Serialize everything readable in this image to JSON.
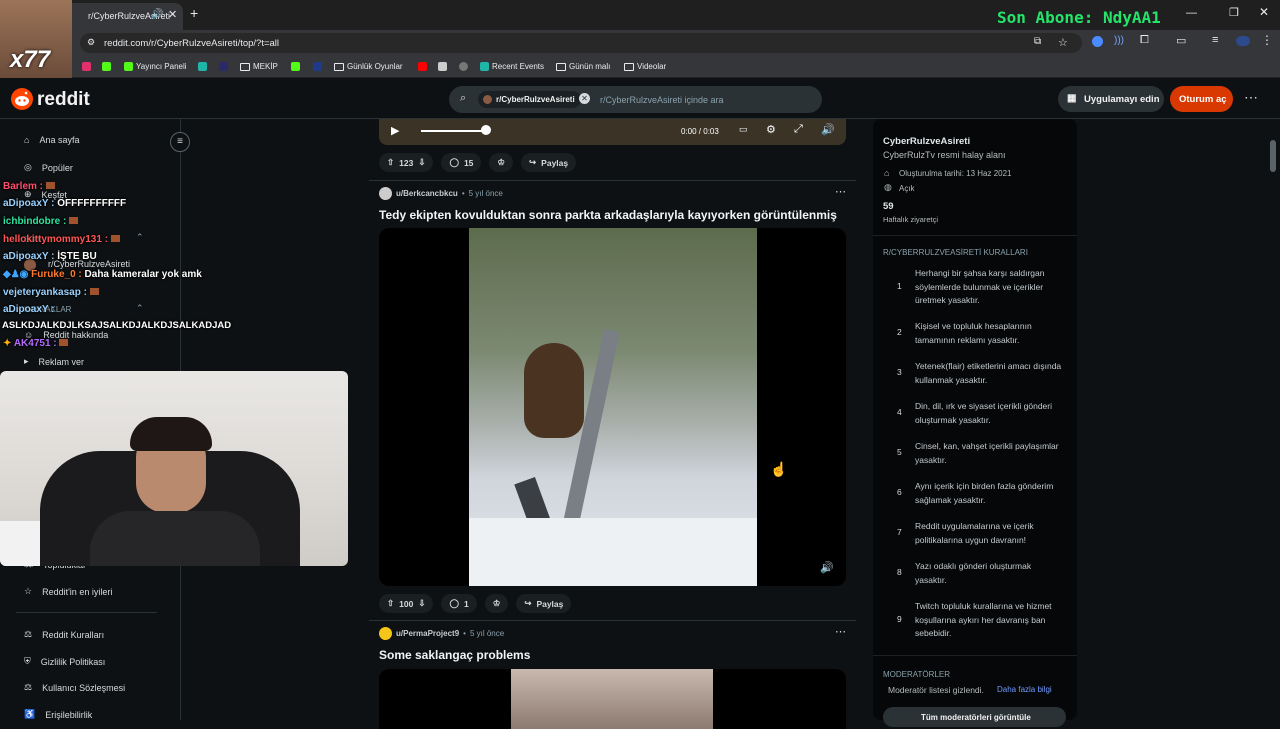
{
  "browser": {
    "tab_title": "r/CyberRulzveAsireti",
    "url": "reddit.com/r/CyberRulzveAsireti/top/?t=all",
    "bookmarks": [
      "Yayıncı Paneli",
      "MEKİP",
      "Günlük Oyunlar",
      "Recent Events",
      "Günün malı",
      "Videolar"
    ]
  },
  "overlay": {
    "sub_banner": "Son Abone: NdyAA1",
    "badge": "x77",
    "chat": [
      {
        "user": "Barlem :",
        "text": "",
        "color": "#ff4d6d"
      },
      {
        "user": "aDipoaxY :",
        "text": "ÖFFFFFFFFFF",
        "color": "#9ad2ff"
      },
      {
        "user": "ichbindobre :",
        "text": "",
        "color": "#30e3a0"
      },
      {
        "user": "hellokittymommy131 :",
        "text": "",
        "color": "#ff5555"
      },
      {
        "user": "aDipoaxY :",
        "text": "İŞTE BU",
        "color": "#9ad2ff"
      },
      {
        "user": "Furuke_0 :",
        "text": "Daha kameralar yok amk",
        "color": "#ff7a2f"
      },
      {
        "user": "vejeteryankasap :",
        "text": "",
        "color": "#9ad2ff"
      },
      {
        "user": "aDipoaxY :",
        "text": "",
        "color": "#9ad2ff"
      },
      {
        "user": "",
        "text": "ASLKDJALKDJLKSAJSALKDJALKDJSALKADJAD",
        "color": "#ffffff"
      },
      {
        "user": "AK4751 :",
        "text": "",
        "color": "#b46cff"
      }
    ]
  },
  "header": {
    "logo": "reddit",
    "search_chip": "r/CyberRulzveAsireti",
    "search_placeholder": "r/CyberRulzveAsireti içinde ara",
    "get_app": "Uygulamayı edin",
    "login": "Oturum aç"
  },
  "left_nav": {
    "home": "Ana sayfa",
    "popular": "Popüler",
    "explore": "Keşfet",
    "recent_label": "SON",
    "recent_item": "r/CyberRulzveAsireti",
    "resources": "KAYNAKLAR",
    "about": "Reddit hakkında",
    "ads": "Reklam ver",
    "communities": "Topluluklar",
    "best": "Reddit'in en iyileri",
    "rules": "Reddit Kuralları",
    "privacy": "Gizlilik Politikası",
    "agreement": "Kullanıcı Sözleşmesi",
    "access": "Erişilebilirlik"
  },
  "feed": {
    "video_time": "0:00 / 0:03",
    "post0": {
      "votes": "123",
      "comments": "15",
      "share": "Paylaş"
    },
    "post1": {
      "author": "u/Berkcancbkcu",
      "age": "5 yıl önce",
      "title": "Tedy ekipten kovulduktan sonra parkta arkadaşlarıyla kayıyorken görüntülenmiş",
      "votes": "100",
      "comments": "1",
      "share": "Paylaş"
    },
    "post2": {
      "author": "u/PermaProject9",
      "age": "5 yıl önce",
      "title": "Some saklangaç problems"
    }
  },
  "sidebar": {
    "name": "CyberRulzveAsireti",
    "desc": "CyberRulzTv resmi halay alanı",
    "created": "Oluşturulma tarihi: 13 Haz 2021",
    "visibility": "Açık",
    "weekly_count": "59",
    "weekly_label": "Haftalık ziyaretçi",
    "rules_heading": "R/CYBERRULZVEASİRETİ KURALLARI",
    "rules": [
      {
        "n": "1",
        "text": "Herhangi bir şahsa karşı saldırgan söylemlerde bulunmak ve içerikler üretmek yasaktır."
      },
      {
        "n": "2",
        "text": "Kişisel ve topluluk hesaplarının tamamının reklamı yasaktır."
      },
      {
        "n": "3",
        "text": "Yetenek(flair) etiketlerini amacı dışında kullanmak yasaktır."
      },
      {
        "n": "4",
        "text": "Din, dil, ırk ve siyaset içerikli gönderi oluşturmak yasaktır."
      },
      {
        "n": "5",
        "text": "Cinsel, kan, vahşet içerikli paylaşımlar yasaktır."
      },
      {
        "n": "6",
        "text": "Aynı içerik için birden fazla gönderim sağlamak yasaktır."
      },
      {
        "n": "7",
        "text": "Reddit uygulamalarına ve içerik politikalarına uygun davranın!"
      },
      {
        "n": "8",
        "text": "Yazı odaklı gönderi oluşturmak yasaktır."
      },
      {
        "n": "9",
        "text": "Twitch topluluk kurallarına ve hizmet koşullarına aykırı her davranış ban sebebidir."
      }
    ],
    "mods_heading": "MODERATÖRLER",
    "mods_hidden": "Moderatör listesi gizlendi.",
    "mods_more": "Daha fazla bilgi",
    "mods_button": "Tüm moderatörleri görüntüle"
  }
}
